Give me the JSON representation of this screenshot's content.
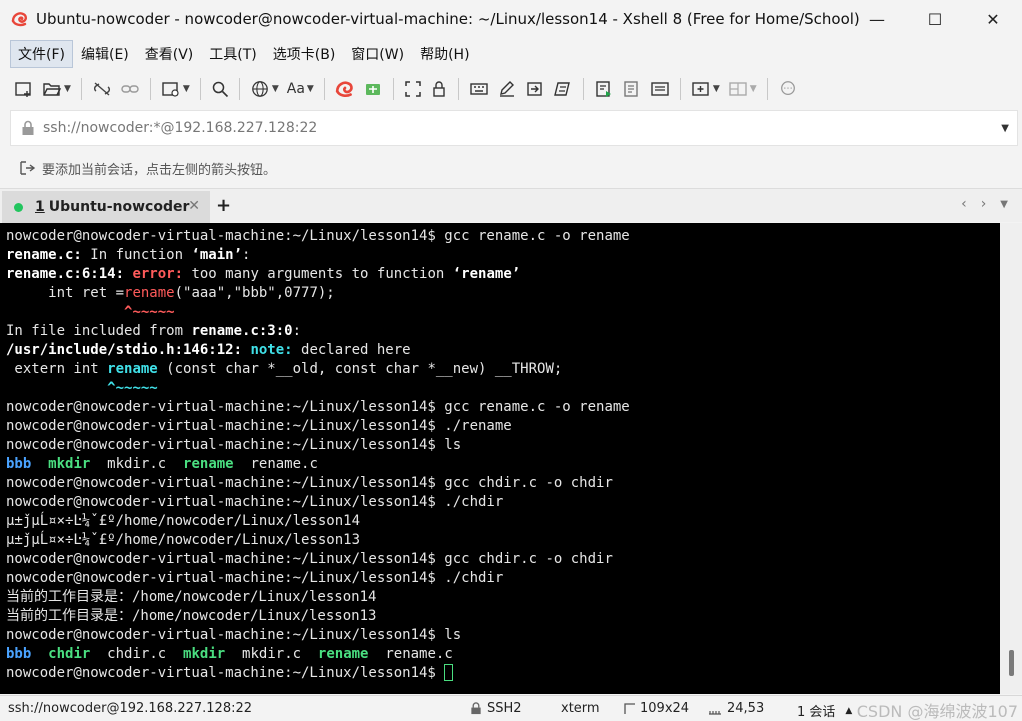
{
  "window": {
    "title": "Ubuntu-nowcoder - nowcoder@nowcoder-virtual-machine: ~/Linux/lesson14 - Xshell 8 (Free for Home/School)",
    "minimize": "—",
    "maximize": "☐",
    "close": "✕"
  },
  "menu": {
    "items": [
      "文件(F)",
      "编辑(E)",
      "查看(V)",
      "工具(T)",
      "选项卡(B)",
      "窗口(W)",
      "帮助(H)"
    ]
  },
  "toolbar": {
    "font_label": "Aa"
  },
  "address": {
    "value": "ssh://nowcoder:*@192.168.227.128:22"
  },
  "hint": {
    "text": "要添加当前会话，点击左侧的箭头按钮。"
  },
  "tabs": {
    "active_num": "1",
    "active_label": "Ubuntu-nowcoder",
    "close": "✕",
    "add": "+",
    "prev": "‹",
    "next": "›"
  },
  "terminal": {
    "lines": [
      [
        [
          "",
          "nowcoder@nowcoder-virtual-machine:~/Linux/lesson14$ gcc rename.c -o rename"
        ]
      ],
      [
        [
          "b",
          "rename.c:"
        ],
        [
          "",
          " In function "
        ],
        [
          "b",
          "‘main’"
        ],
        [
          "",
          ":"
        ]
      ],
      [
        [
          "b",
          "rename.c:6:14: "
        ],
        [
          "red",
          "error: "
        ],
        [
          "",
          "too many arguments to function "
        ],
        [
          "b",
          "‘rename’"
        ]
      ],
      [
        [
          "",
          "     int ret ="
        ],
        [
          "redn",
          "rename"
        ],
        [
          "",
          "(\"aaa\",\"bbb\",0777);"
        ]
      ],
      [
        [
          "",
          "              "
        ],
        [
          "red",
          "^~~~~~"
        ]
      ],
      [
        [
          "",
          "In file included from "
        ],
        [
          "b",
          "rename.c:3:0"
        ],
        [
          "",
          ":"
        ]
      ],
      [
        [
          "b",
          "/usr/include/stdio.h:146:12: "
        ],
        [
          "cyan",
          "note: "
        ],
        [
          "",
          "declared here"
        ]
      ],
      [
        [
          "",
          " extern int "
        ],
        [
          "cyan",
          "rename"
        ],
        [
          "",
          " (const char *__old, const char *__new) __THROW;"
        ]
      ],
      [
        [
          "",
          "            "
        ],
        [
          "cyan",
          "^~~~~~"
        ]
      ],
      [
        [
          "",
          "nowcoder@nowcoder-virtual-machine:~/Linux/lesson14$ gcc rename.c -o rename"
        ]
      ],
      [
        [
          "",
          "nowcoder@nowcoder-virtual-machine:~/Linux/lesson14$ ./rename"
        ]
      ],
      [
        [
          "",
          "nowcoder@nowcoder-virtual-machine:~/Linux/lesson14$ ls"
        ]
      ],
      [
        [
          "blue",
          "bbb"
        ],
        [
          "",
          "  "
        ],
        [
          "green",
          "mkdir"
        ],
        [
          "",
          "  mkdir.c  "
        ],
        [
          "green",
          "rename"
        ],
        [
          "",
          "  rename.c"
        ]
      ],
      [
        [
          "",
          "nowcoder@nowcoder-virtual-machine:~/Linux/lesson14$ gcc chdir.c -o chdir"
        ]
      ],
      [
        [
          "",
          "nowcoder@nowcoder-virtual-machine:~/Linux/lesson14$ ./chdir"
        ]
      ],
      [
        [
          "",
          "µ±ǰµĹ¤×÷Ŀ¼ˇ£º/home/nowcoder/Linux/lesson14"
        ]
      ],
      [
        [
          "",
          "µ±ǰµĹ¤×÷Ŀ¼ˇ£º/home/nowcoder/Linux/lesson13"
        ]
      ],
      [
        [
          "",
          "nowcoder@nowcoder-virtual-machine:~/Linux/lesson14$ gcc chdir.c -o chdir"
        ]
      ],
      [
        [
          "",
          "nowcoder@nowcoder-virtual-machine:~/Linux/lesson14$ ./chdir"
        ]
      ],
      [
        [
          "",
          "当前的工作目录是：/home/nowcoder/Linux/lesson14"
        ]
      ],
      [
        [
          "",
          "当前的工作目录是：/home/nowcoder/Linux/lesson13"
        ]
      ],
      [
        [
          "",
          "nowcoder@nowcoder-virtual-machine:~/Linux/lesson14$ ls"
        ]
      ],
      [
        [
          "blue",
          "bbb"
        ],
        [
          "",
          "  "
        ],
        [
          "green",
          "chdir"
        ],
        [
          "",
          "  chdir.c  "
        ],
        [
          "green",
          "mkdir"
        ],
        [
          "",
          "  mkdir.c  "
        ],
        [
          "green",
          "rename"
        ],
        [
          "",
          "  rename.c"
        ]
      ],
      [
        [
          "",
          "nowcoder@nowcoder-virtual-machine:~/Linux/lesson14$ "
        ],
        [
          "cursor",
          ""
        ]
      ]
    ]
  },
  "status": {
    "connection": "ssh://nowcoder@192.168.227.128:22",
    "protocol": "SSH2",
    "term": "xterm",
    "size": "109x24",
    "position": "24,53",
    "sessions": "1 会话",
    "watermark": "CSDN @海绵波波107"
  },
  "colors": {
    "terminal_bg": "#000000",
    "prompt_fg": "#e6e6e6",
    "error_red": "#ff5b5b",
    "note_cyan": "#40e0e8",
    "dir_blue": "#4aa3ff",
    "exec_green": "#4ade80",
    "tab_active_dot": "#22c55e"
  }
}
